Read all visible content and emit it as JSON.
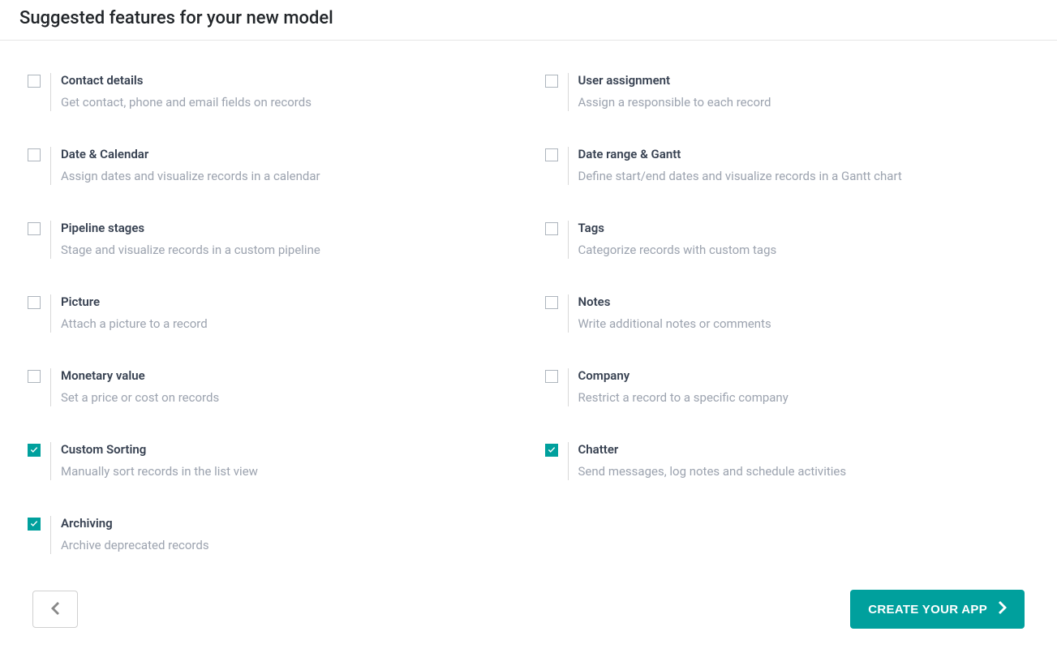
{
  "page": {
    "title": "Suggested features for your new model"
  },
  "features": [
    {
      "id": "contact-details",
      "title": "Contact details",
      "desc": "Get contact, phone and email fields on records",
      "checked": false
    },
    {
      "id": "user-assignment",
      "title": "User assignment",
      "desc": "Assign a responsible to each record",
      "checked": false
    },
    {
      "id": "date-calendar",
      "title": "Date & Calendar",
      "desc": "Assign dates and visualize records in a calendar",
      "checked": false
    },
    {
      "id": "date-range-gantt",
      "title": "Date range & Gantt",
      "desc": "Define start/end dates and visualize records in a Gantt chart",
      "checked": false
    },
    {
      "id": "pipeline-stages",
      "title": "Pipeline stages",
      "desc": "Stage and visualize records in a custom pipeline",
      "checked": false
    },
    {
      "id": "tags",
      "title": "Tags",
      "desc": "Categorize records with custom tags",
      "checked": false
    },
    {
      "id": "picture",
      "title": "Picture",
      "desc": "Attach a picture to a record",
      "checked": false
    },
    {
      "id": "notes",
      "title": "Notes",
      "desc": "Write additional notes or comments",
      "checked": false
    },
    {
      "id": "monetary-value",
      "title": "Monetary value",
      "desc": "Set a price or cost on records",
      "checked": false
    },
    {
      "id": "company",
      "title": "Company",
      "desc": "Restrict a record to a specific company",
      "checked": false
    },
    {
      "id": "custom-sorting",
      "title": "Custom Sorting",
      "desc": "Manually sort records in the list view",
      "checked": true
    },
    {
      "id": "chatter",
      "title": "Chatter",
      "desc": "Send messages, log notes and schedule activities",
      "checked": true
    },
    {
      "id": "archiving",
      "title": "Archiving",
      "desc": "Archive deprecated records",
      "checked": true
    }
  ],
  "footer": {
    "create_label": "CREATE YOUR APP"
  },
  "colors": {
    "accent": "#00a09d"
  }
}
